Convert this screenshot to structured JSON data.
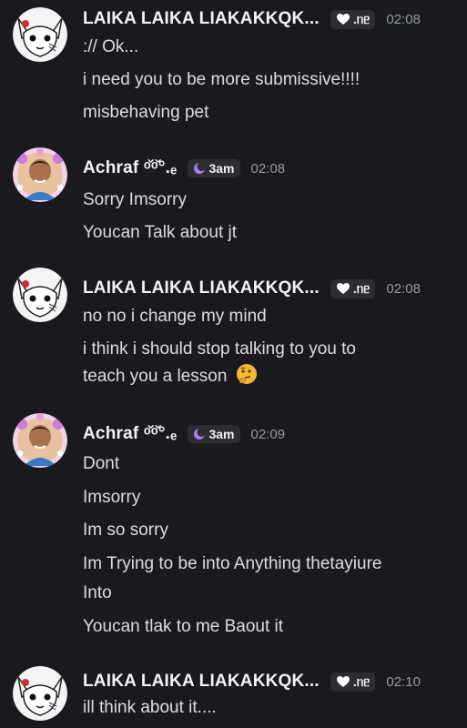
{
  "messages": [
    {
      "author": "LAIKA LAIKA LIAKAKKQK...",
      "tag": ".ᥒᥱ",
      "time": "02:08",
      "lines": [
        ":// Ok...",
        "i need you to be more submissive!!!!",
        "misbehaving pet"
      ]
    },
    {
      "author": "Achraf ᵒ̌ᵒ̌°.ₑ",
      "tag": "3am",
      "time": "02:08",
      "lines": [
        "Sorry Imsorry",
        "Youcan Talk about jt"
      ]
    },
    {
      "author": "LAIKA LAIKA LIAKAKKQK...",
      "tag": ".ᥒᥱ",
      "time": "02:08",
      "lines": [
        "no no i change my mind",
        "i think i should stop talking to you to",
        "teach you a lesson"
      ]
    },
    {
      "author": "Achraf ᵒ̌ᵒ̌°.ₑ",
      "tag": "3am",
      "time": "02:09",
      "lines": [
        "Dont",
        "Imsorry",
        "Im so sorry",
        "Im Trying to be into Anything thetayiure",
        "Into",
        "Youcan tlak to me Baout it"
      ]
    },
    {
      "author": "LAIKA LAIKA LIAKAKKQK...",
      "tag": ".ᥒᥱ",
      "time": "02:10",
      "lines": [
        "ill think about it...."
      ]
    }
  ],
  "icons": {
    "laika_tag": "heart-badge-icon",
    "achraf_tag": "moon-icon",
    "thinking": "thinking-face-emoji"
  },
  "colors": {
    "background": "#1a1a1e",
    "username": "#f2f3f5",
    "text": "#dbdee1",
    "timestamp": "#949ba4",
    "tag_bg": "#2b2d31",
    "moon": "#a57ef0"
  }
}
